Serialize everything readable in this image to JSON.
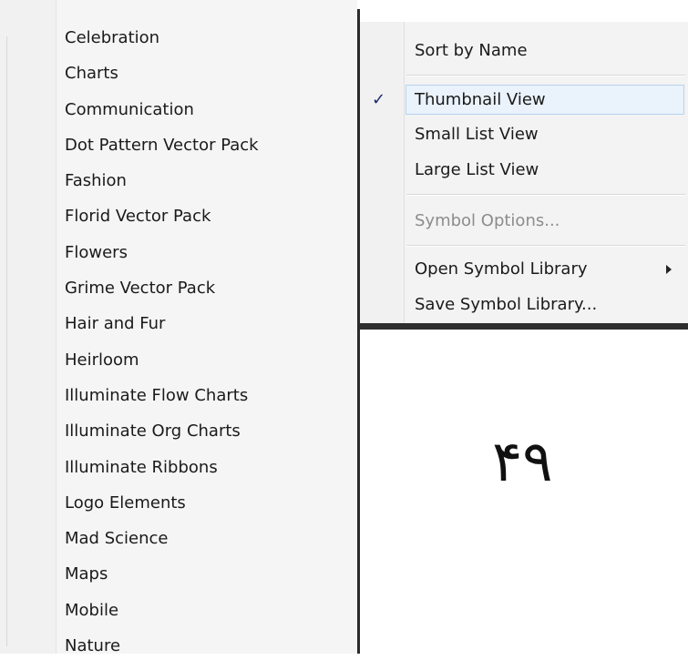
{
  "library_list": {
    "items": [
      "Celebration",
      "Charts",
      "Communication",
      "Dot Pattern Vector Pack",
      "Fashion",
      "Florid Vector Pack",
      "Flowers",
      "Grime Vector Pack",
      "Hair and Fur",
      "Heirloom",
      "Illuminate Flow Charts",
      "Illuminate Org Charts",
      "Illuminate Ribbons",
      "Logo Elements",
      "Mad Science",
      "Maps",
      "Mobile",
      "Nature"
    ]
  },
  "context_menu": {
    "sort_by_name": "Sort by Name",
    "check_mark": "✓",
    "thumbnail_view": "Thumbnail View",
    "small_list_view": "Small List View",
    "large_list_view": "Large List View",
    "symbol_options": "Symbol Options...",
    "open_symbol_library": "Open Symbol Library",
    "save_symbol_library": "Save Symbol Library...",
    "checked_item": "Thumbnail View",
    "highlighted_item": "Thumbnail View",
    "disabled_item": "Symbol Options..."
  },
  "page_number": "۴۹",
  "colors": {
    "menu_background": "#f3f3f3",
    "highlight_fill": "#eaf2fb",
    "highlight_border": "#b7d3ef",
    "disabled_text": "#8c8c8c",
    "menu_border": "#2b2b2b"
  },
  "icons": {
    "check": "check-mark-icon",
    "submenu": "submenu-arrow-icon"
  }
}
